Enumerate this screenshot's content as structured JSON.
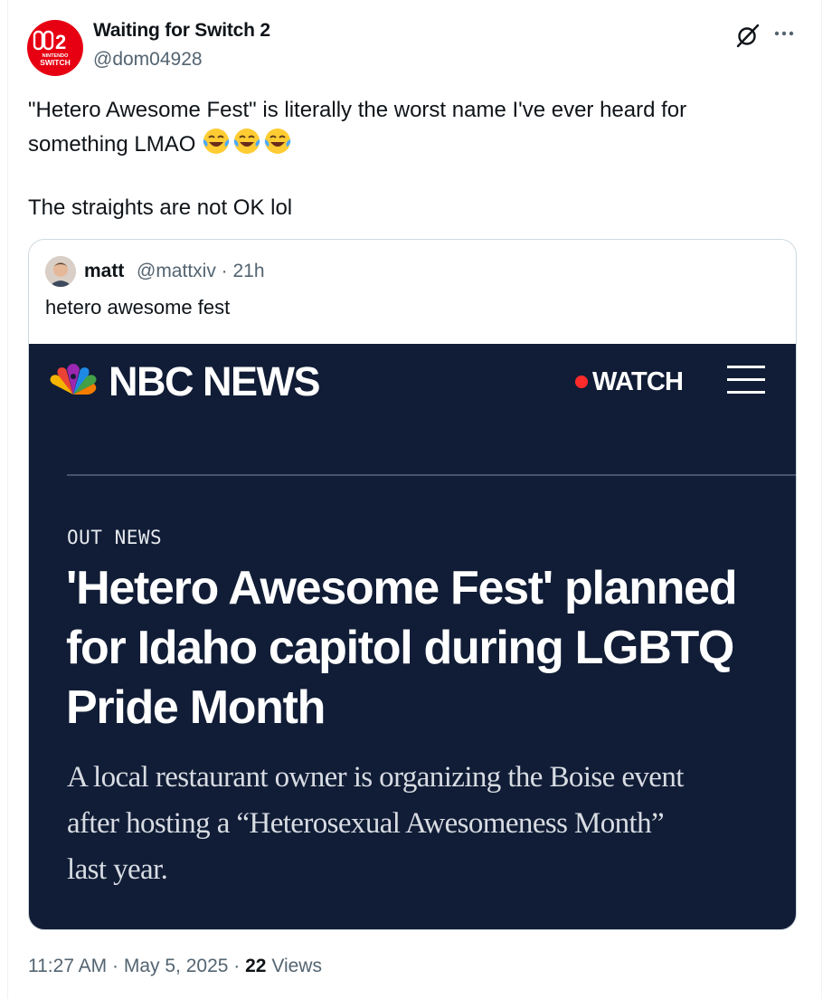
{
  "tweet": {
    "author": {
      "name": "Waiting for Switch 2",
      "handle": "@dom04928",
      "avatar_badge": "2",
      "avatar_caption_1": "NINTENDO",
      "avatar_caption_2": "SWITCH"
    },
    "text_lines": [
      "\"Hetero Awesome Fest\" is literally the worst name I've ever heard for",
      "something LMAO",
      "",
      "The straights are not OK lol"
    ],
    "emoji": [
      "face-with-tears-of-joy",
      "face-with-tears-of-joy",
      "face-with-tears-of-joy"
    ],
    "icons": {
      "grok": "grok-icon",
      "more": "more-icon"
    },
    "time": "11:27 AM",
    "date": "May 5, 2025",
    "separator": "·",
    "views_count": "22",
    "views_label": "Views"
  },
  "quote": {
    "author": {
      "name": "matt",
      "handle_time": "@mattxiv · 21h"
    },
    "text": "hetero awesome fest",
    "article": {
      "brand": "NBC NEWS",
      "watch_label": "WATCH",
      "section": "OUT NEWS",
      "headline_lines": [
        "'Hetero Awesome Fest' planned",
        "for Idaho capitol during LGBTQ",
        "Pride Month"
      ],
      "dek_lines": [
        "A local restaurant owner is organizing the Boise event",
        "after hosting a “Heterosexual Awesomeness Month”",
        "last year."
      ],
      "colors": {
        "background": "#111d36",
        "watch_dot": "#ff2b2b"
      }
    }
  }
}
